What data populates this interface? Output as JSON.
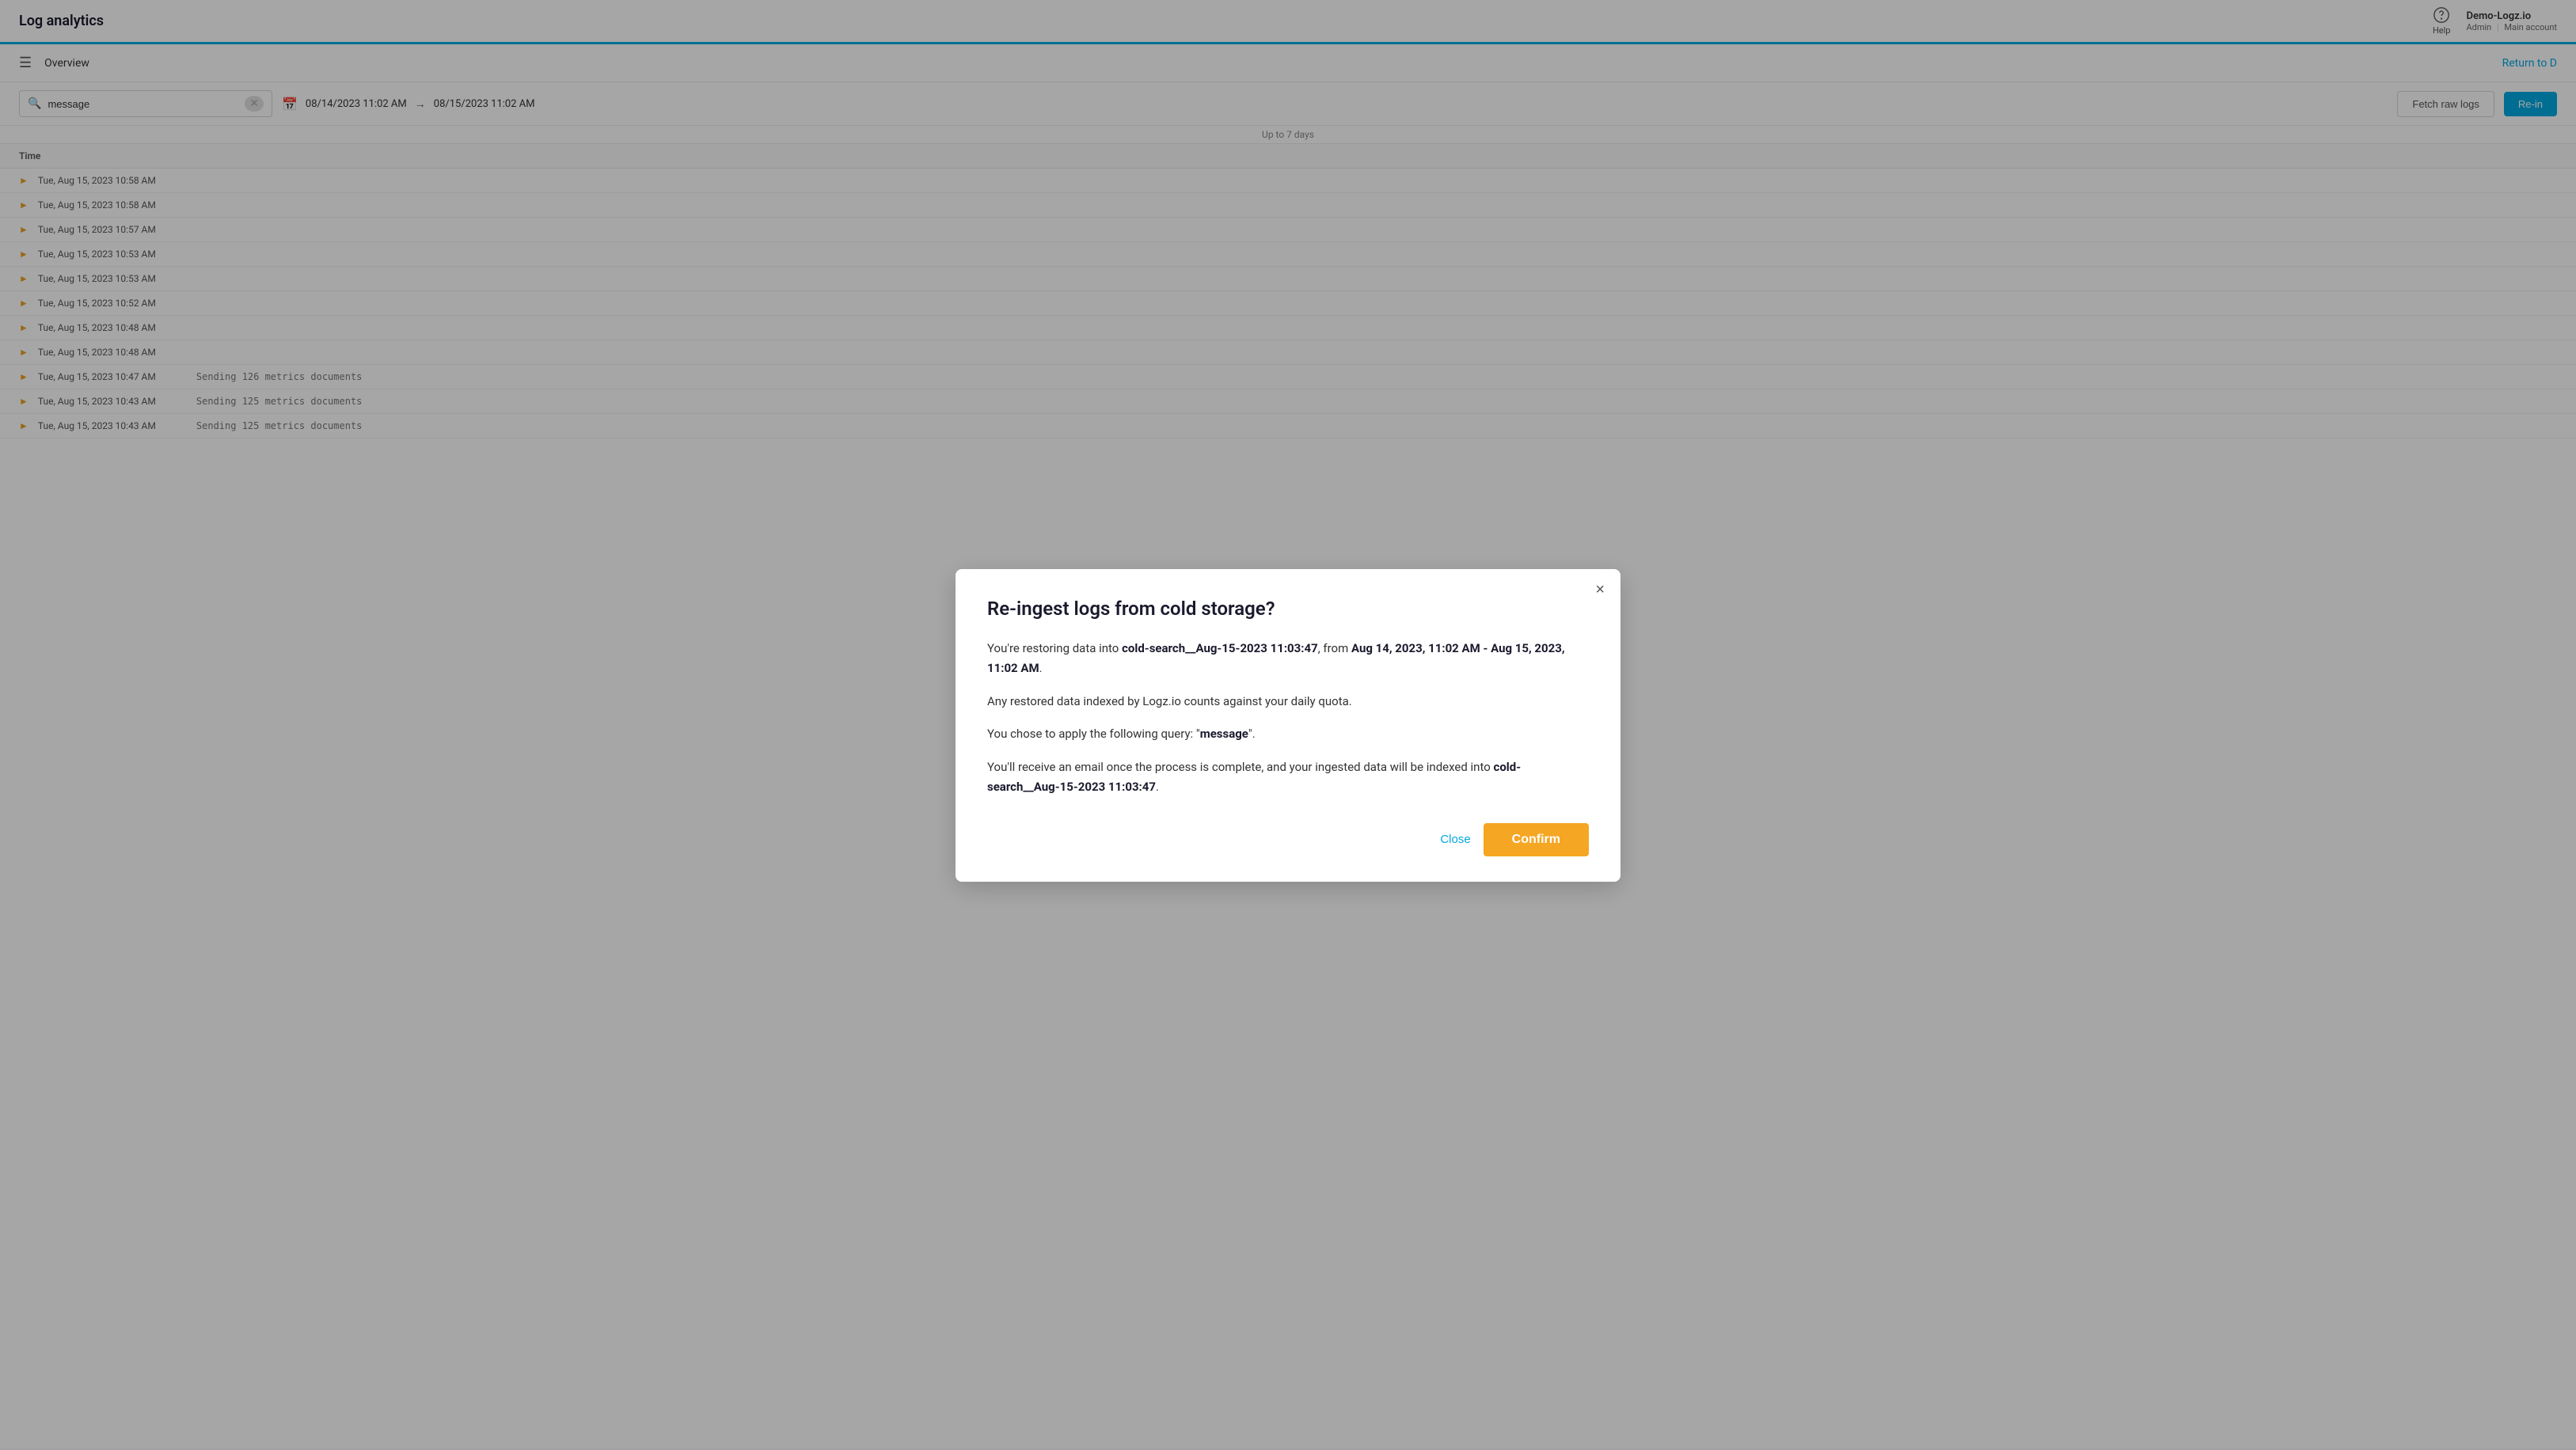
{
  "header": {
    "app_title": "Log analytics",
    "help_label": "Help",
    "account_name": "Demo-Logz.io",
    "account_role": "Admin",
    "account_type": "Main account"
  },
  "subnav": {
    "overview_label": "Overview",
    "return_label": "Return to D"
  },
  "filter_bar": {
    "search_value": "message",
    "search_placeholder": "message",
    "date_from": "08/14/2023 11:02 AM",
    "date_to": "08/15/2023 11:02 AM",
    "fetch_label": "Fetch raw logs",
    "reingest_label": "Re-in"
  },
  "quota_note": "Up to 7 days",
  "log_table": {
    "column_time": "Time",
    "rows": [
      {
        "time": "Tue, Aug 15, 2023 10:58 AM",
        "message": ""
      },
      {
        "time": "Tue, Aug 15, 2023 10:58 AM",
        "message": ""
      },
      {
        "time": "Tue, Aug 15, 2023 10:57 AM",
        "message": ""
      },
      {
        "time": "Tue, Aug 15, 2023 10:53 AM",
        "message": ""
      },
      {
        "time": "Tue, Aug 15, 2023 10:53 AM",
        "message": ""
      },
      {
        "time": "Tue, Aug 15, 2023 10:52 AM",
        "message": ""
      },
      {
        "time": "Tue, Aug 15, 2023 10:48 AM",
        "message": ""
      },
      {
        "time": "Tue, Aug 15, 2023 10:48 AM",
        "message": ""
      },
      {
        "time": "Tue, Aug 15, 2023 10:47 AM",
        "message": "Sending 126 metrics documents"
      },
      {
        "time": "Tue, Aug 15, 2023 10:43 AM",
        "message": "Sending 125 metrics documents"
      },
      {
        "time": "Tue, Aug 15, 2023 10:43 AM",
        "message": "Sending 125 metrics documents"
      }
    ]
  },
  "modal": {
    "title": "Re-ingest logs from cold storage?",
    "close_button": "×",
    "paragraph1_prefix": "You're restoring data into ",
    "paragraph1_bold1": "cold-search__Aug-15-2023 11:03:47",
    "paragraph1_mid": ", from ",
    "paragraph1_bold2": "Aug 14, 2023, 11:02 AM - Aug 15, 2023, 11:02 AM",
    "paragraph1_suffix": ".",
    "paragraph2": "Any restored data indexed by Logz.io counts against your daily quota.",
    "paragraph3_prefix": "You chose to apply the following query: \"",
    "paragraph3_bold": "message",
    "paragraph3_suffix": "\".",
    "paragraph4_prefix": "You'll receive an email once the process is complete, and your ingested data will be indexed into ",
    "paragraph4_bold": "cold-search__Aug-15-2023 11:03:47",
    "paragraph4_suffix": ".",
    "close_label": "Close",
    "confirm_label": "Confirm"
  }
}
